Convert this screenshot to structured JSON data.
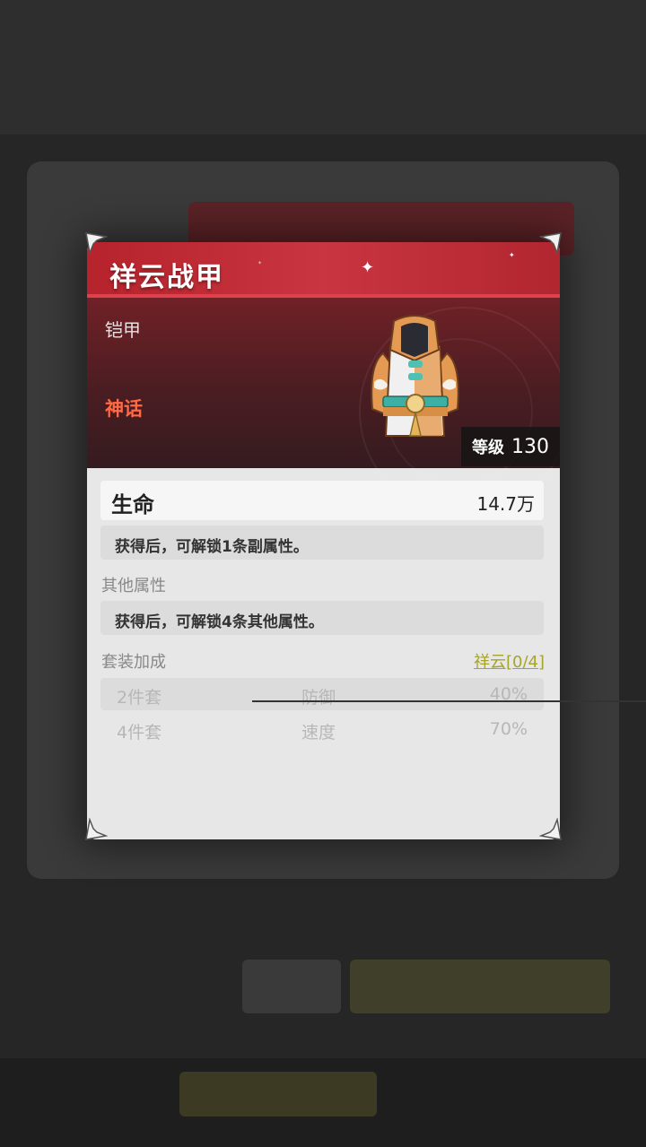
{
  "item": {
    "name": "祥云战甲",
    "type": "铠甲",
    "rarity": "神话",
    "level_label": "等级",
    "level_value": "130"
  },
  "main_stat": {
    "label": "生命",
    "value": "14.7万",
    "note": "获得后，可解锁1条副属性。"
  },
  "other_stats": {
    "label": "其他属性",
    "note": "获得后，可解锁4条其他属性。"
  },
  "set_bonus": {
    "label": "套装加成",
    "set_link": "祥云[0/4]",
    "rows": [
      {
        "pieces": "2件套",
        "stat": "防御",
        "value": "40%"
      },
      {
        "pieces": "4件套",
        "stat": "速度",
        "value": "70%"
      }
    ]
  },
  "colors": {
    "header_red": "#c93540",
    "rarity_orange": "#ff6a45",
    "set_link_olive": "#a7a42a"
  },
  "icons": [
    "corner-ornament-icon",
    "sparkle-icon",
    "armor-item-icon"
  ]
}
